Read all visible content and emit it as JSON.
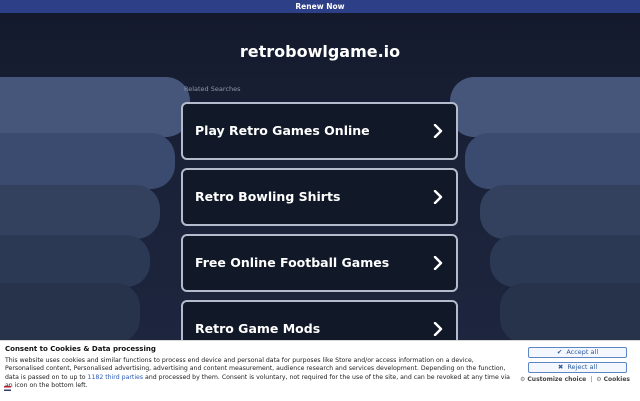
{
  "topbar": {
    "renew_label": "Renew Now"
  },
  "header": {
    "domain": "retrobowlgame.io"
  },
  "related": {
    "label": "Related Searches"
  },
  "links": [
    {
      "label": "Play Retro Games Online"
    },
    {
      "label": "Retro Bowling Shirts"
    },
    {
      "label": "Free Online Football Games"
    },
    {
      "label": "Retro Game Mods"
    }
  ],
  "consent": {
    "title": "Consent to Cookies & Data processing",
    "body_before_link": "This website uses cookies and similar functions to process end device and personal data for purposes like Store and/or access information on a device, Personalised content, Personalised advertising, advertising and content measurement, audience research and services development. Depending on the function, data is passed on to up to ",
    "third_parties_link": "1182 third parties",
    "body_after_link": " and processed by them. Consent is voluntary, not required for the use of the site, and can be revoked at any time via an icon on the bottom left.",
    "accept_label": "Accept all",
    "reject_label": "Reject all",
    "customize_label": "Customize choice",
    "cookies_label": "Cookies"
  },
  "colors": {
    "topbar": "#2d3f86",
    "background": "#151b2e",
    "link_background": "#111828",
    "link_border": "#b4bbcc",
    "consent_button": "#2c5aa0"
  }
}
